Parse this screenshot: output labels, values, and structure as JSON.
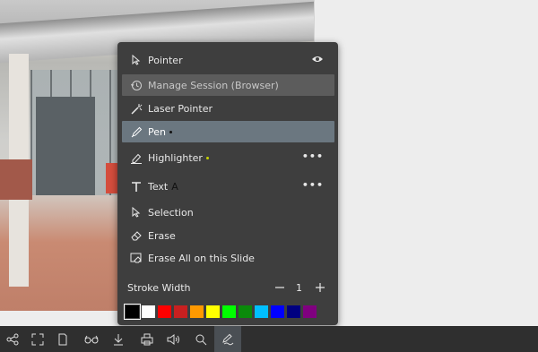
{
  "menu": {
    "items": [
      {
        "label": "Pointer",
        "icon": "pointer-icon"
      },
      {
        "label": "Manage Session (Browser)",
        "icon": "history-icon"
      },
      {
        "label": "Laser Pointer",
        "icon": "laser-icon"
      },
      {
        "label": "Pen",
        "icon": "pen-icon"
      },
      {
        "label": "Highlighter",
        "icon": "highlighter-icon"
      },
      {
        "label": "Text",
        "icon": "text-icon",
        "preview": "A"
      },
      {
        "label": "Selection",
        "icon": "selection-icon"
      },
      {
        "label": "Erase",
        "icon": "eraser-icon"
      },
      {
        "label": "Erase All on this Slide",
        "icon": "erase-all-icon"
      }
    ],
    "more_label": "•••",
    "stroke_width_label": "Stroke Width",
    "stroke_width_value": "1",
    "colors": [
      "#000000",
      "#ffffff",
      "#ff0000",
      "#c82020",
      "#ff9900",
      "#ffff00",
      "#00ff00",
      "#0a8a0a",
      "#00bfff",
      "#0000ff",
      "#000080",
      "#800080"
    ],
    "active_color": "#000000"
  },
  "toolbar": {
    "buttons": [
      "share-icon",
      "fullscreen-icon",
      "page-icon",
      "glasses-icon",
      "download-icon",
      "print-icon",
      "speaker-icon",
      "search-icon",
      "annotate-icon"
    ],
    "active": "annotate-icon"
  }
}
